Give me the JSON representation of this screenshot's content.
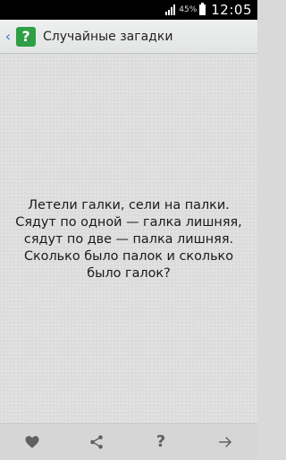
{
  "status_bar": {
    "battery_percent": "45%",
    "time": "12:05"
  },
  "action_bar": {
    "back_icon": "chevron-left-icon",
    "app_icon_glyph": "?",
    "title": "Случайные загадки"
  },
  "riddle": {
    "text": "Летели галки, сели на палки. Сядут по одной — галка лишняя, сядут по две — палка лишняя. Сколько было палок и сколько было галок?"
  },
  "bottom_bar": {
    "favorite_icon": "heart-icon",
    "share_icon": "share-icon",
    "answer_label": "?",
    "next_icon": "arrow-right-icon"
  }
}
